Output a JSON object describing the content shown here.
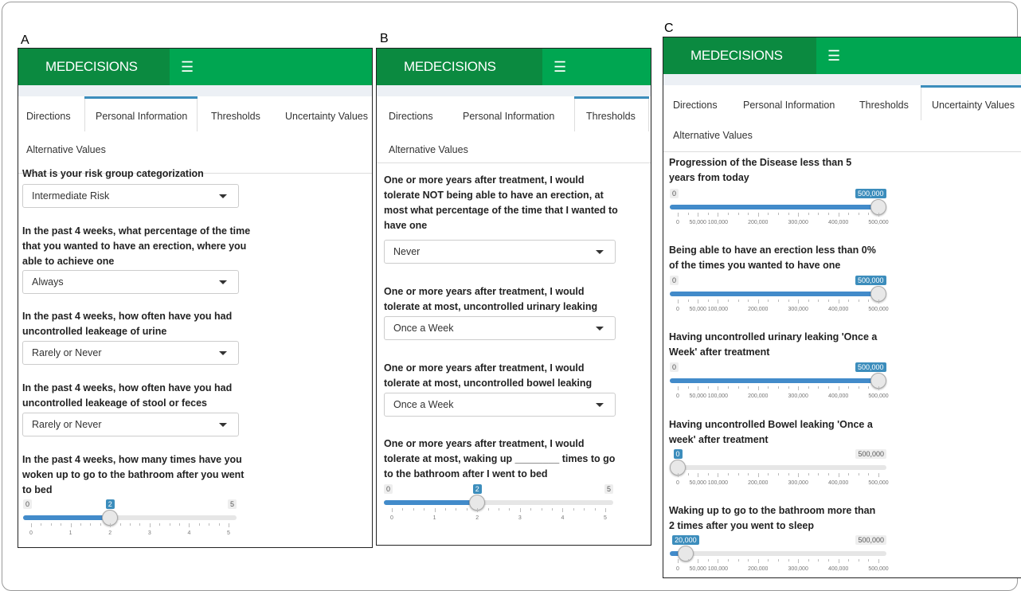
{
  "panel_labels": [
    "A",
    "B",
    "C"
  ],
  "app": {
    "brand": "MEDECISIONS",
    "menu_icon": "hamburger-icon"
  },
  "tabs": {
    "directions": "Directions",
    "personal": "Personal Information",
    "thresholds": "Thresholds",
    "uncertainty": "Uncertainty Values",
    "alternative": "Alternative Values"
  },
  "panelA": {
    "active_tab": "Personal Information",
    "q1": "What is your risk group categorization",
    "s1": "Intermediate Risk",
    "q2": "In the past 4 weeks, what percentage of the time that you wanted to have an erection, where you able to achieve one",
    "s2": "Always",
    "q3": "In the past 4 weeks, how often have you had uncontrolled leakeage of urine",
    "s3": "Rarely or Never",
    "q4": "In the past 4 weeks, how often have you had uncontrolled leakeage of stool or feces",
    "s4": "Rarely or Never",
    "q5": "In the past 4 weeks, how many times have you woken up to go to the bathroom after you went to bed",
    "slider": {
      "min": "0",
      "max": "5",
      "value": "2",
      "fraction": 0.4,
      "ticks": [
        "0",
        "1",
        "2",
        "3",
        "4",
        "5"
      ]
    }
  },
  "panelB": {
    "active_tab": "Thresholds",
    "q1": "One or more years after treatment, I would tolerate NOT being able to have an erection, at most what percentage of the time that I wanted to have one",
    "s1": "Never",
    "q2": "One or more years after treatment, I would tolerate at most, uncontrolled urinary leaking",
    "s2": "Once a Week",
    "q3": "One or more years after treatment, I would tolerate at most, uncontrolled bowel leaking",
    "s3": "Once a Week",
    "q4": "One or more years after treatment, I would tolerate at most, waking up ________ times to go to the bathroom after I went to bed",
    "slider": {
      "min": "0",
      "max": "5",
      "value": "2",
      "fraction": 0.4,
      "ticks": [
        "0",
        "1",
        "2",
        "3",
        "4",
        "5"
      ]
    }
  },
  "panelC": {
    "active_tab": "Uncertainty Values",
    "q1": "Progression of the Disease less than 5 years from today",
    "q2": "Being able to have an erection less than 0% of the times you wanted to have one",
    "q3": "Having uncontrolled urinary leaking 'Once a Week' after treatment",
    "q4": "Having uncontrolled Bowel leaking 'Once a week' after treatment",
    "q5": "Waking up to go to the bathroom more than 2 times after you went to sleep",
    "sliders": [
      {
        "min": "0",
        "max": "500,000",
        "value": "500,000",
        "fraction": 1.0
      },
      {
        "min": "0",
        "max": "500,000",
        "value": "500,000",
        "fraction": 1.0
      },
      {
        "min": "0",
        "max": "500,000",
        "value": "500,000",
        "fraction": 1.0
      },
      {
        "min": "0",
        "max": "500,000",
        "value": "0",
        "fraction": 0.0
      },
      {
        "min": "0",
        "max": "500,000",
        "value": "20,000",
        "fraction": 0.04
      }
    ],
    "ticks": [
      "0",
      "50,000",
      "100,000",
      "200,000",
      "300,000",
      "400,000",
      "500,000"
    ],
    "tick_values": [
      0,
      50000,
      100000,
      200000,
      300000,
      400000,
      500000
    ]
  },
  "colors": {
    "header": "#00a651",
    "brand": "#0b8a40",
    "accent": "#3c8dbc",
    "fill": "#428bca"
  }
}
